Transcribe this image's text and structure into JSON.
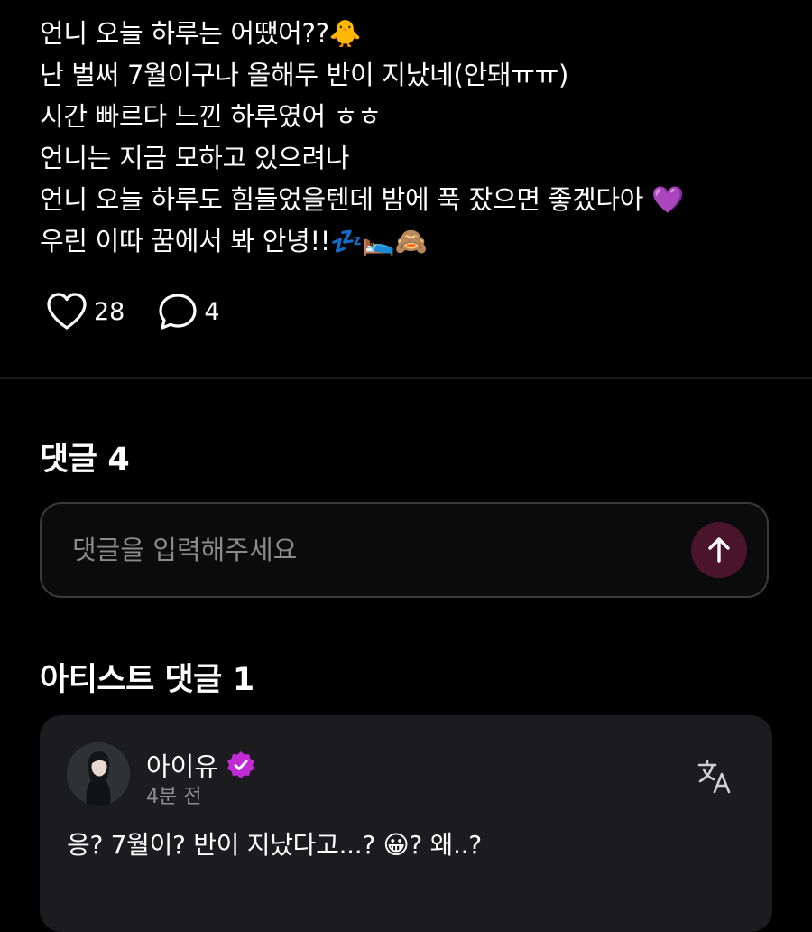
{
  "post": {
    "lines": [
      "언니 오늘 하루는 어땠어??🐥",
      "난 벌써 7월이구나 올해두 반이 지났네(안돼ㅠㅠ)",
      "시간 빠르다 느낀 하루였어 ㅎㅎ",
      "언니는 지금 모하고 있으려나",
      "언니 오늘 하루도 힘들었을텐데 밤에 푹 잤으면 좋겠다아 💜",
      "우린 이따 꿈에서 봐 안녕!!💤🛌🙈"
    ],
    "like_count": "28",
    "comment_count": "4",
    "like_icon": "heart-outline-icon",
    "comment_icon": "speech-bubble-icon"
  },
  "comments_section": {
    "title": "댓글",
    "count": "4",
    "input_placeholder": "댓글을 입력해주세요",
    "send_icon": "arrow-up-icon"
  },
  "artist_section": {
    "title": "아티스트 댓글",
    "count": "1",
    "comment": {
      "author": "아이유",
      "time": "4분 전",
      "text": "응? 7월이? 반이 지났다고...? 😀? 왜..?",
      "verified_icon": "verified-badge-icon",
      "translate_icon": "translate-icon"
    }
  },
  "colors": {
    "background": "#000000",
    "card": "#1c1c1e",
    "send_button": "#4a1429",
    "verified": "#c02bd6",
    "muted_text": "#8e8e93"
  }
}
